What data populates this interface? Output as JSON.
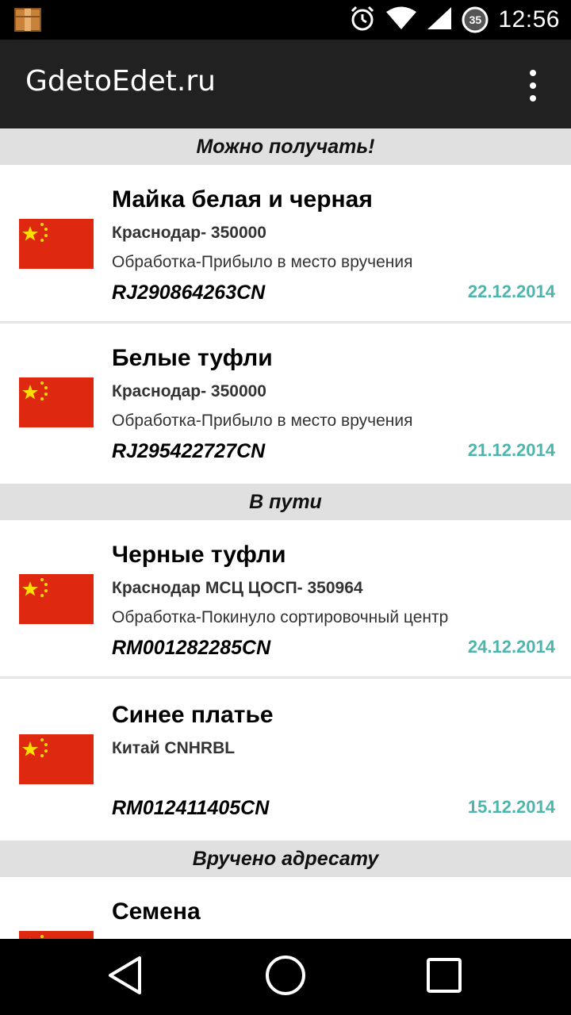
{
  "status_bar": {
    "time": "12:56",
    "battery_level": "35",
    "icons": [
      "package-app-icon",
      "alarm-icon",
      "wifi-icon",
      "signal-icon",
      "battery-icon"
    ]
  },
  "action_bar": {
    "title": "GdetoEdet.ru",
    "overflow_icon": "more-vert-icon"
  },
  "sections": [
    {
      "header": "Можно получать!",
      "items": [
        {
          "name": "Майка белая и черная",
          "location": "Краснодар- 350000",
          "status": "Обработка-Прибыло в место вручения",
          "track": "RJ290864263CN",
          "date": "22.12.2014",
          "flag": "china-flag-icon"
        },
        {
          "name": "Белые туфли",
          "location": "Краснодар- 350000",
          "status": "Обработка-Прибыло в место вручения",
          "track": "RJ295422727CN",
          "date": "21.12.2014",
          "flag": "china-flag-icon"
        }
      ]
    },
    {
      "header": "В пути",
      "items": [
        {
          "name": "Черные туфли",
          "location": "Краснодар МСЦ ЦОСП- 350964",
          "status": "Обработка-Покинуло сортировочный центр",
          "track": "RM001282285CN",
          "date": "24.12.2014",
          "flag": "china-flag-icon"
        },
        {
          "name": "Синее платье",
          "location": "Китай CNHRBL",
          "status": "",
          "track": "RM012411405CN",
          "date": "15.12.2014",
          "flag": "china-flag-icon"
        }
      ]
    },
    {
      "header": "Вручено адресату",
      "items": [
        {
          "name": "Семена",
          "location": "",
          "status": "",
          "track": "",
          "date": "",
          "flag": "china-flag-icon"
        }
      ]
    }
  ],
  "nav_bar": {
    "icons": [
      "back-icon",
      "home-icon",
      "recents-icon"
    ]
  },
  "colors": {
    "action_bar": "#212121",
    "section_header": "#e0e0e0",
    "date_accent": "#4db6ac",
    "flag_red": "#de2910",
    "flag_star": "#ffde00"
  }
}
